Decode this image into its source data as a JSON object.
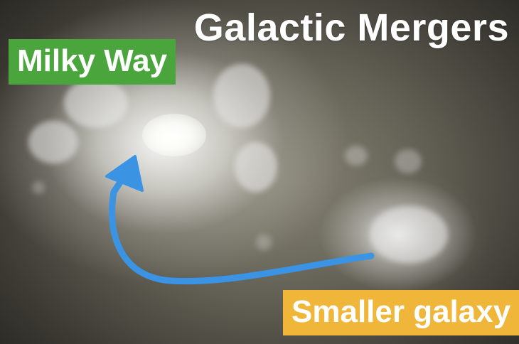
{
  "title": "Galactic Mergers",
  "labels": {
    "milky_way": "Milky Way",
    "smaller_galaxy": "Smaller galaxy"
  },
  "colors": {
    "milky_way_box": "#4aa63c",
    "smaller_galaxy_box": "#efb63a",
    "arrow": "#3b93e4"
  }
}
